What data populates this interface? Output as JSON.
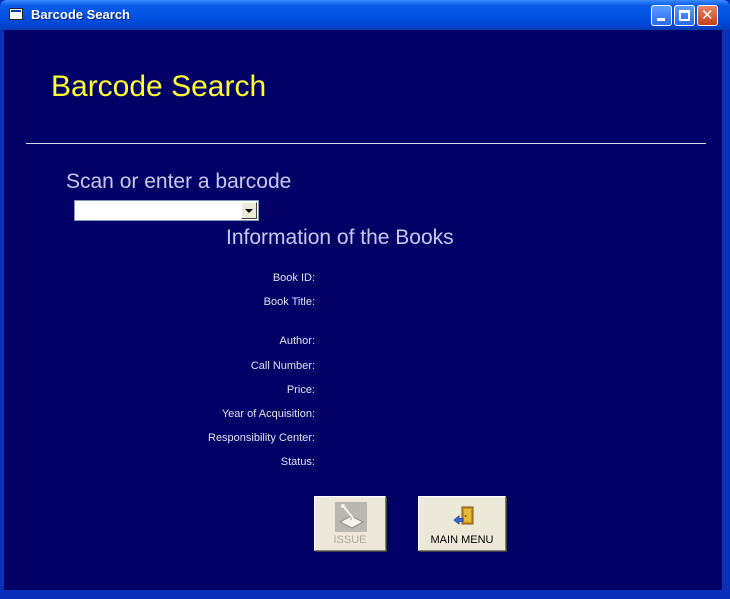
{
  "window": {
    "title": "Barcode Search"
  },
  "page": {
    "heading": "Barcode Search",
    "scan_label": "Scan or enter a barcode",
    "barcode_value": "",
    "info_title": "Information of the Books"
  },
  "fields": [
    {
      "label": "Book ID:",
      "value": ""
    },
    {
      "label": "Book Title:",
      "value": ""
    },
    {
      "label": "Author:",
      "value": ""
    },
    {
      "label": "Call Number:",
      "value": ""
    },
    {
      "label": "Price:",
      "value": ""
    },
    {
      "label": "Year of Acquisition:",
      "value": ""
    },
    {
      "label": "Responsibility Center:",
      "value": ""
    },
    {
      "label": "Status:",
      "value": ""
    }
  ],
  "buttons": {
    "issue": {
      "label": "ISSUE",
      "icon": "book-scan-icon",
      "enabled": false
    },
    "main_menu": {
      "label": "MAIN MENU",
      "icon": "exit-door-icon",
      "enabled": true
    }
  },
  "colors": {
    "background": "#000066",
    "heading": "#ffff33",
    "label": "#c8c8f0"
  }
}
